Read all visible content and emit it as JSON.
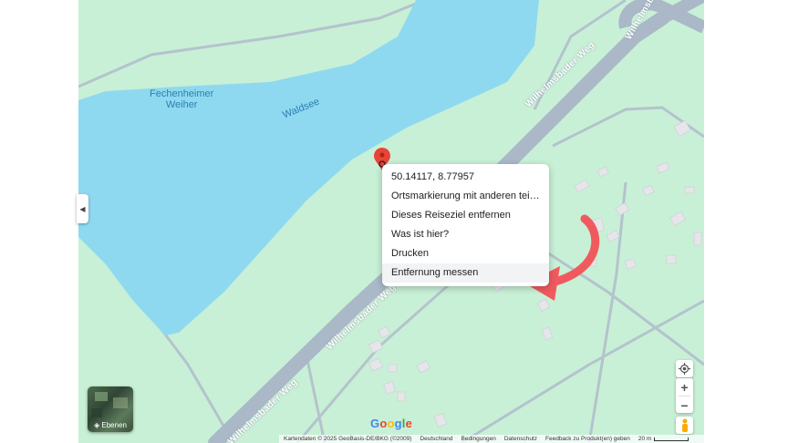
{
  "map": {
    "water_labels": {
      "pond_name_line1": "Fechenheimer",
      "pond_name_line2": "Weiher",
      "lake_name": "Waldsee"
    },
    "road_labels": {
      "upper": "Wilhelmsbader Weg",
      "middle": "Wilhelmsbader Weg",
      "lower": "Wilhelmsbader Weg",
      "top_right": "Wilhelmsbader Weg"
    },
    "colors": {
      "land": "#c8f0d6",
      "water": "#8fd9f0",
      "road": "#aab8c8",
      "path": "#b4c3cd",
      "building": "#e6e6ea",
      "pin": "#ea4335",
      "arrow": "#f05a5f"
    }
  },
  "context_menu": {
    "items": [
      {
        "label": "50.14117, 8.77957"
      },
      {
        "label": "Ortsmarkierung mit anderen teilen"
      },
      {
        "label": "Dieses Reiseziel entfernen"
      },
      {
        "label": "Was ist hier?"
      },
      {
        "label": "Drucken"
      },
      {
        "label": "Entfernung messen"
      }
    ]
  },
  "controls": {
    "layers_label": "Ebenen",
    "locate_icon": "my-location-icon",
    "zoom_in": "+",
    "zoom_out": "−",
    "pegman_icon": "street-view-pegman-icon",
    "collapse_icon": "chevron-left-icon",
    "collapse_glyph": "◀"
  },
  "branding": {
    "google_letters": [
      "G",
      "o",
      "o",
      "g",
      "l",
      "e"
    ],
    "google_colors": [
      "#4285f4",
      "#ea4335",
      "#fbbc05",
      "#4285f4",
      "#34a853",
      "#ea4335"
    ]
  },
  "footer": {
    "attribution": "Kartendaten © 2025 GeoBasis-DE/BKG (©2009)",
    "country": "Deutschland",
    "terms": "Bedingungen",
    "privacy": "Datenschutz",
    "feedback": "Feedback zu Produkt(en) geben",
    "scale": "20 m"
  }
}
